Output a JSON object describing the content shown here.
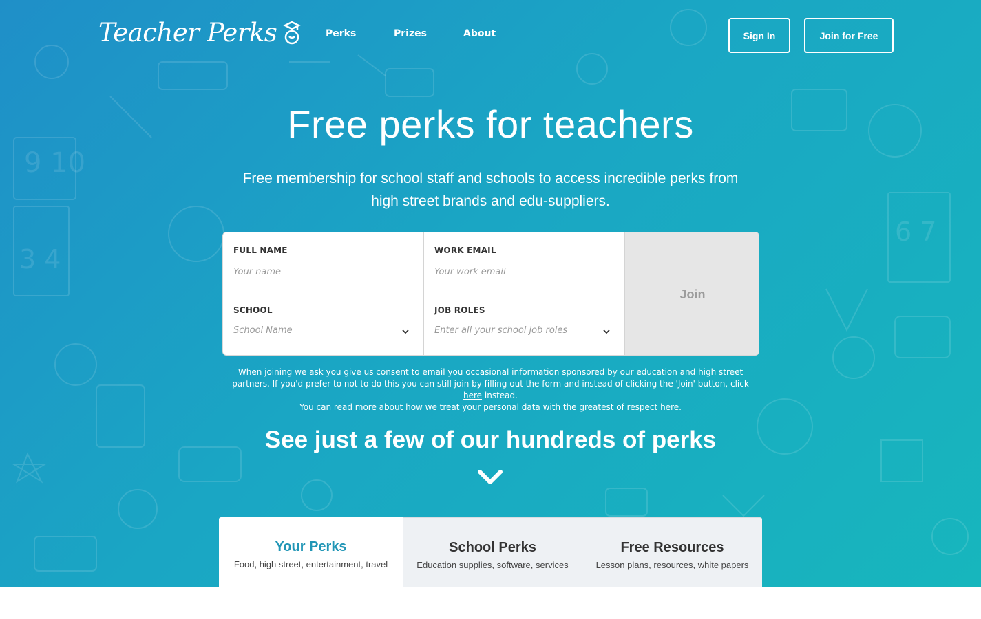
{
  "header": {
    "logo_text": "Teacher Perks",
    "logo_icon": "bear-graduate-icon",
    "nav": [
      {
        "label": "Perks"
      },
      {
        "label": "Prizes"
      },
      {
        "label": "About"
      }
    ],
    "sign_in_label": "Sign In",
    "join_free_label": "Join for Free"
  },
  "hero": {
    "title": "Free perks for teachers",
    "subtitle": "Free membership for school staff and schools to access incredible perks from high street brands and edu-suppliers."
  },
  "form": {
    "full_name": {
      "label": "FULL NAME",
      "placeholder": "Your name",
      "value": ""
    },
    "work_email": {
      "label": "WORK EMAIL",
      "placeholder": "Your work email",
      "value": ""
    },
    "school": {
      "label": "SCHOOL",
      "placeholder": "School Name"
    },
    "job_roles": {
      "label": "JOB ROLES",
      "placeholder": "Enter all your school job roles"
    },
    "join_label": "Join"
  },
  "consent": {
    "line1": "When joining we ask you give us consent to email you occasional information sponsored by our education and high street partners. If you'd prefer to not to do this you can still join by filling out the form and instead of clicking the 'Join' button, click",
    "link1": "here",
    "after1": "instead.",
    "line2": "You can read more about how we treat your personal data with the greatest of respect",
    "link2": "here",
    "after2": "."
  },
  "perks_section": {
    "heading": "See just a few of our hundreds of perks",
    "tabs": [
      {
        "title": "Your Perks",
        "desc": "Food, high street, entertainment, travel",
        "active": true
      },
      {
        "title": "School Perks",
        "desc": "Education supplies, software, services",
        "active": false
      },
      {
        "title": "Free Resources",
        "desc": "Lesson plans, resources, white papers",
        "active": false
      }
    ]
  },
  "colors": {
    "gradient_start": "#1f8fc8",
    "gradient_end": "#17b6bd",
    "active_tab_title": "#2196b6",
    "join_button_bg": "#e6e6e6"
  }
}
